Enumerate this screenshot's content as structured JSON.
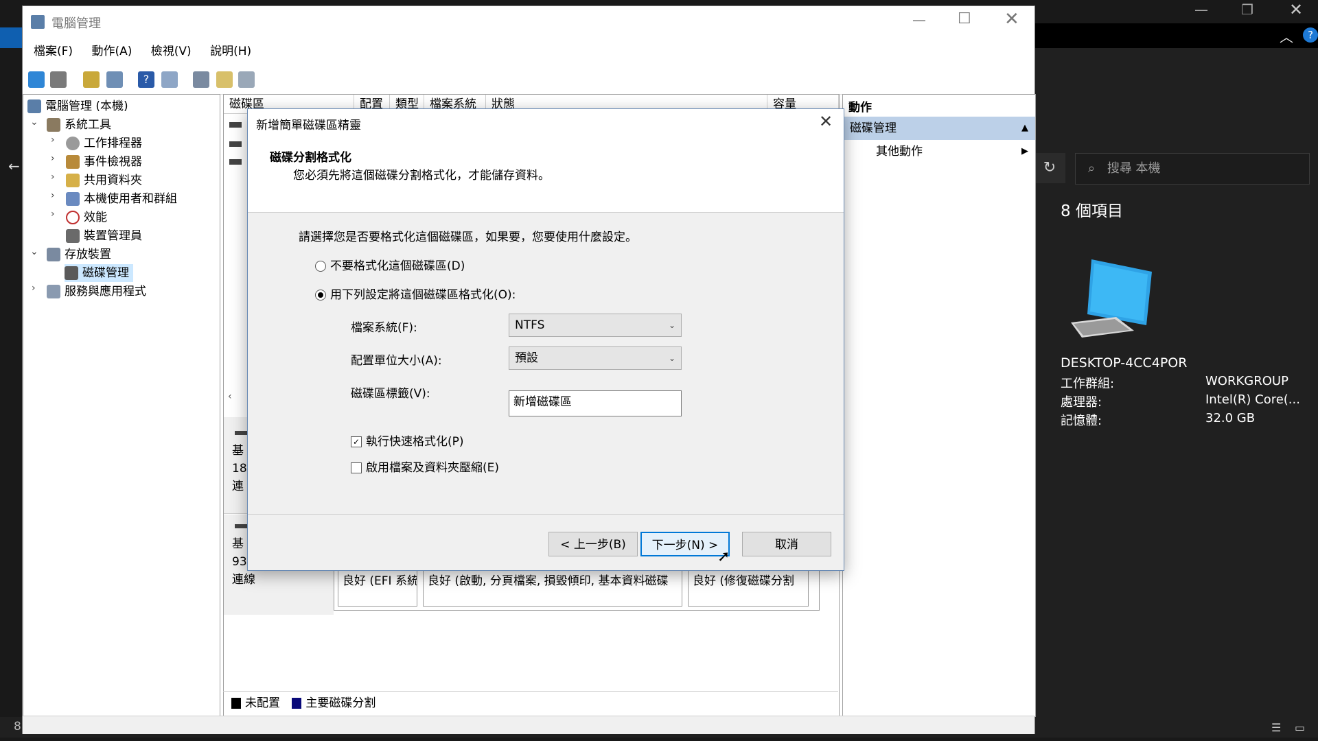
{
  "window": {
    "title": "電腦管理",
    "menu": [
      "檔案(F)",
      "動作(A)",
      "檢視(V)",
      "說明(H)"
    ]
  },
  "tree": {
    "root": "電腦管理 (本機)",
    "system_tools": "系統工具",
    "task_scheduler": "工作排程器",
    "event_viewer": "事件檢視器",
    "shared_folders": "共用資料夾",
    "local_users": "本機使用者和群組",
    "performance": "效能",
    "device_manager": "裝置管理員",
    "storage": "存放裝置",
    "disk_management": "磁碟管理",
    "services": "服務與應用程式"
  },
  "columns": [
    "磁碟區",
    "配置",
    "類型",
    "檔案系統",
    "狀態",
    "容量"
  ],
  "disks": {
    "disk0_info": [
      "基",
      "18",
      "連"
    ],
    "disk1_info": [
      "基",
      "93",
      "連線"
    ],
    "partitions": [
      "良好 (EFI 系統",
      "良好 (啟動, 分頁檔案, 損毀傾印, 基本資料磁碟",
      "良好 (修復磁碟分割"
    ]
  },
  "legend": {
    "unallocated": "未配置",
    "primary": "主要磁碟分割",
    "unallocated_color": "#000000",
    "primary_color": "#0a0a7a"
  },
  "actions": {
    "header": "動作",
    "section": "磁碟管理",
    "more": "其他動作"
  },
  "dialog": {
    "title": "新增簡單磁碟區精靈",
    "heading": "磁碟分割格式化",
    "subheading": "您必須先將這個磁碟分割格式化，才能儲存資料。",
    "prompt": "請選擇您是否要格式化這個磁碟區，如果要，您要使用什麼設定。",
    "opt_no_format": "不要格式化這個磁碟區(D)",
    "opt_format": "用下列設定將這個磁碟區格式化(O):",
    "fs_label": "檔案系統(F):",
    "fs_value": "NTFS",
    "alloc_label": "配置單位大小(A):",
    "alloc_value": "預設",
    "vol_label": "磁碟區標籤(V):",
    "vol_value": "新增磁碟區",
    "quick_format": "執行快速格式化(P)",
    "compression": "啟用檔案及資料夾壓縮(E)",
    "back": "< 上一步(B)",
    "next": "下一步(N) >",
    "cancel": "取消"
  },
  "explorer": {
    "search_placeholder": "搜尋 本機",
    "item_count": "8 個項目",
    "pc_name": "DESKTOP-4CC4POR",
    "workgroup_label": "工作群組:",
    "workgroup_value": "WORKGROUP",
    "cpu_label": "處理器:",
    "cpu_value": "Intel(R) Core(...",
    "ram_label": "記憶體:",
    "ram_value": "32.0 GB",
    "left_char": "8"
  }
}
